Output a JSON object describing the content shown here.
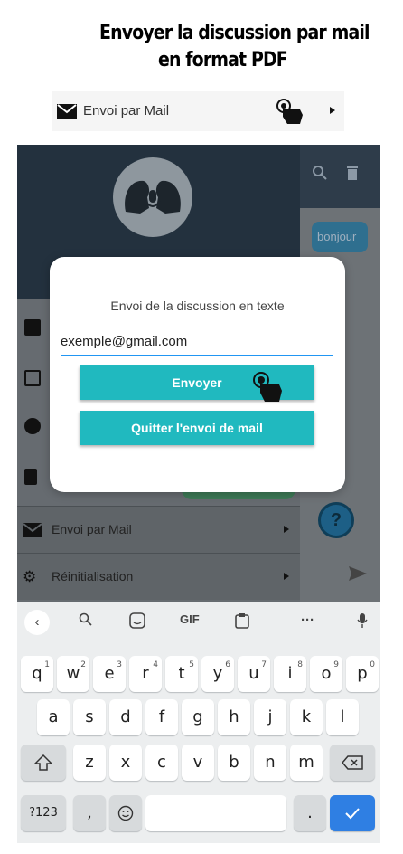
{
  "headline": {
    "line1": "Envoyer la discussion par mail",
    "line2": "en format PDF"
  },
  "menu_preview": {
    "label": "Envoi par Mail"
  },
  "chat": {
    "bubble_text": "bonjour"
  },
  "drawer": {
    "items": [
      {
        "label": "Envoi par Mail"
      },
      {
        "label": "Réinitialisation"
      }
    ]
  },
  "dialog": {
    "title": "Envoi de la discussion en texte",
    "email_value": "exemple@gmail.com",
    "send_label": "Envoyer",
    "quit_label": "Quitter l'envoi de mail"
  },
  "keyboard": {
    "toolbar": {
      "gif": "GIF",
      "more": "···"
    },
    "row1": [
      "q",
      "w",
      "e",
      "r",
      "t",
      "y",
      "u",
      "i",
      "o",
      "p"
    ],
    "row1_hints": [
      "1",
      "2",
      "3",
      "4",
      "5",
      "6",
      "7",
      "8",
      "9",
      "0"
    ],
    "row2": [
      "a",
      "s",
      "d",
      "f",
      "g",
      "h",
      "j",
      "k",
      "l"
    ],
    "row3": [
      "z",
      "x",
      "c",
      "v",
      "b",
      "n",
      "m"
    ],
    "mode_key": "?123",
    "comma": ",",
    "period": ".",
    "help_glyph": "?"
  }
}
